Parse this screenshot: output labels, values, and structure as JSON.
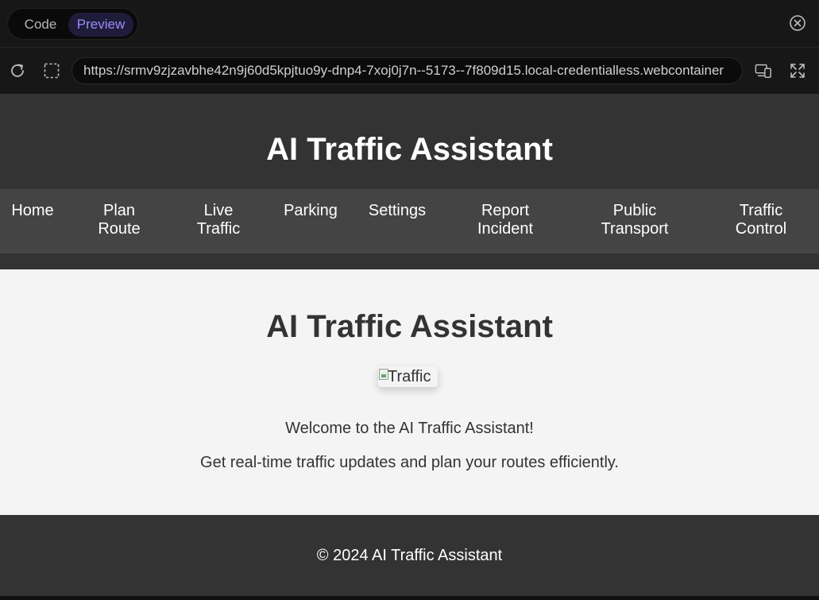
{
  "toolbar": {
    "code_label": "Code",
    "preview_label": "Preview",
    "accent_color": "#9d8cf5"
  },
  "address_bar": {
    "url": "https://srmv9zjzavbhe42n9j60d5kpjtuo9y-dnp4-7xoj0j7n--5173--7f809d15.local-credentialless.webcontainer"
  },
  "page": {
    "header": {
      "title": "AI Traffic Assistant"
    },
    "nav": [
      {
        "line1": "Home",
        "line2": ""
      },
      {
        "line1": "Plan",
        "line2": "Route"
      },
      {
        "line1": "Live",
        "line2": "Traffic"
      },
      {
        "line1": "Parking",
        "line2": ""
      },
      {
        "line1": "Settings",
        "line2": ""
      },
      {
        "line1": "Report",
        "line2": "Incident"
      },
      {
        "line1": "Public",
        "line2": "Transport"
      },
      {
        "line1": "Traffic",
        "line2": "Control"
      }
    ],
    "main": {
      "title": "AI Traffic Assistant",
      "image_alt": "Traffic",
      "welcome": "Welcome to the AI Traffic Assistant!",
      "tagline": "Get real-time traffic updates and plan your routes efficiently."
    },
    "footer": {
      "text": "© 2024 AI Traffic Assistant"
    }
  }
}
